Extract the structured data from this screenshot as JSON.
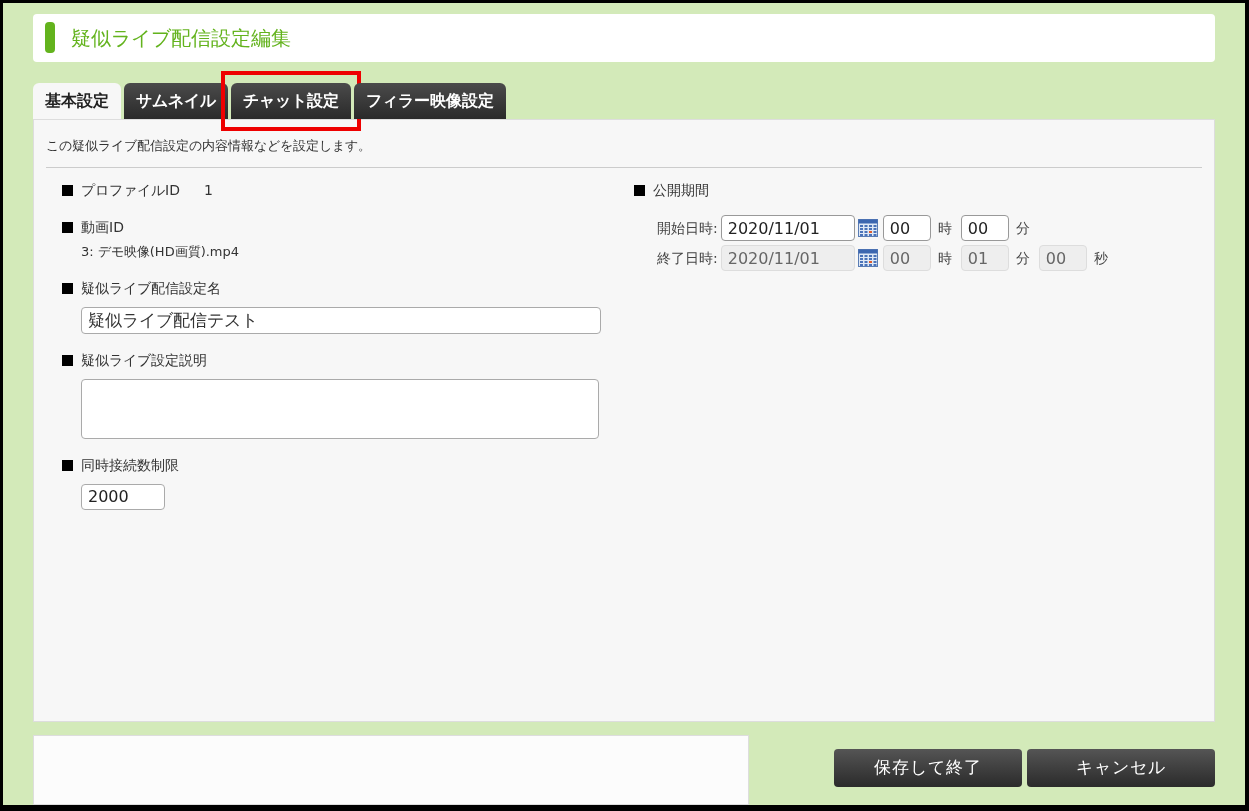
{
  "page_title": "疑似ライブ配信設定編集",
  "tabs": [
    {
      "label": "基本設定",
      "selected": true,
      "highlighted": false
    },
    {
      "label": "サムネイル",
      "selected": false,
      "highlighted": false
    },
    {
      "label": "チャット設定",
      "selected": false,
      "highlighted": true
    },
    {
      "label": "フィラー映像設定",
      "selected": false,
      "highlighted": false
    }
  ],
  "description": "この疑似ライブ配信設定の内容情報などを設定します。",
  "left_fields": [
    {
      "kind": "inline",
      "label": "プロファイルID",
      "value": "1"
    },
    {
      "kind": "text",
      "label": "動画ID",
      "value": "3: デモ映像(HD画質).mp4"
    },
    {
      "kind": "input",
      "label": "疑似ライブ配信設定名",
      "value": "疑似ライブ配信テスト"
    },
    {
      "kind": "textarea",
      "label": "疑似ライブ設定説明"
    },
    {
      "kind": "short_input",
      "label": "同時接続数制限",
      "value": "2000"
    }
  ],
  "period": {
    "label": "公開期間",
    "rows": [
      {
        "label": "開始日時:",
        "disabled": false,
        "date": "2020/11/01",
        "parts": [
          {
            "value": "00",
            "unit": "時"
          },
          {
            "value": "00",
            "unit": "分"
          }
        ]
      },
      {
        "label": "終了日時:",
        "disabled": true,
        "date": "2020/11/01",
        "parts": [
          {
            "value": "00",
            "unit": "時"
          },
          {
            "value": "01",
            "unit": "分"
          },
          {
            "value": "00",
            "unit": "秒"
          }
        ]
      }
    ]
  },
  "buttons": [
    "保存して終了",
    "キャンセル"
  ]
}
